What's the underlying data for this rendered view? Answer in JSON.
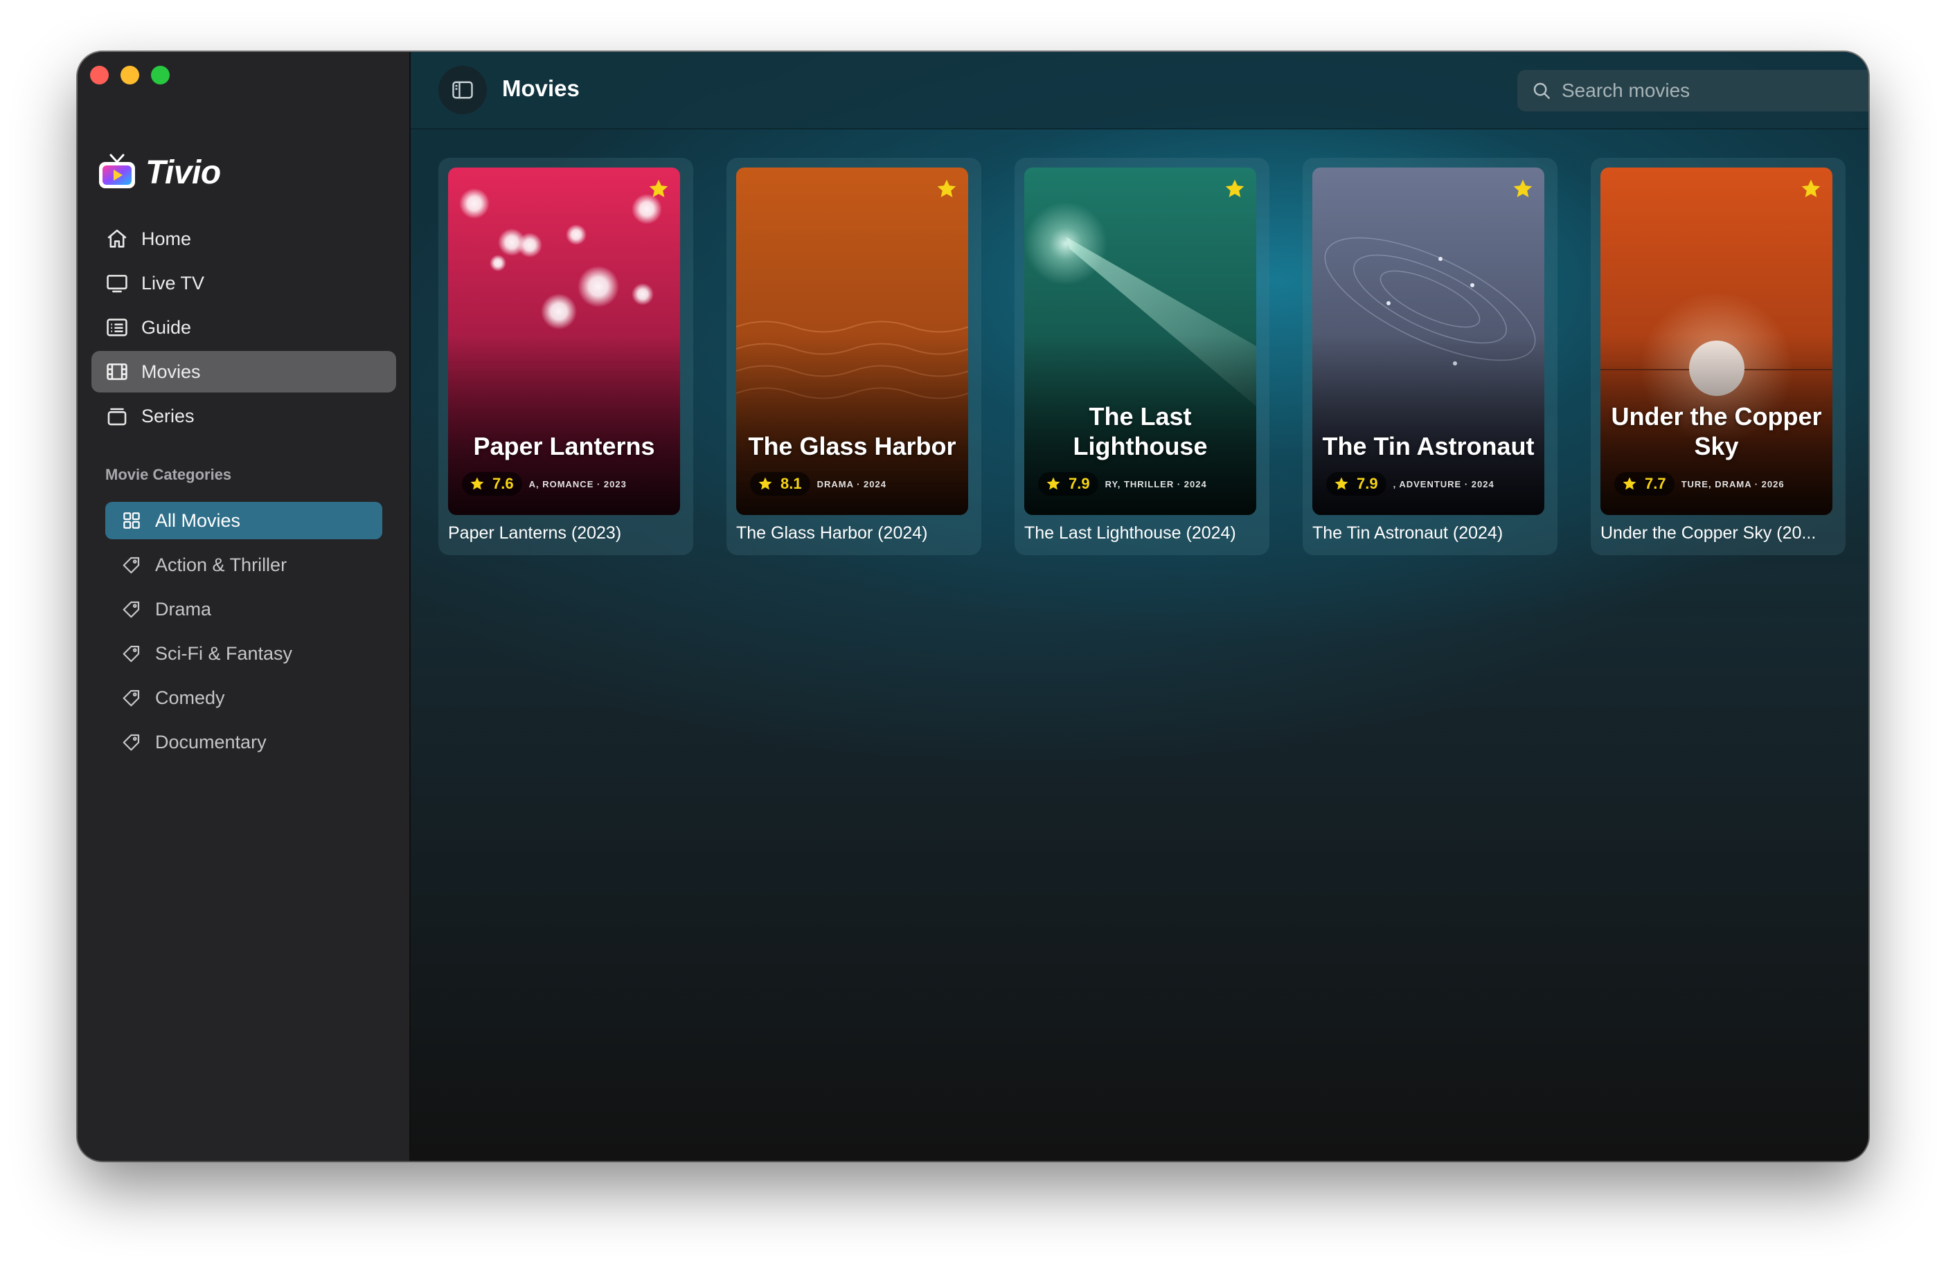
{
  "app": {
    "name": "Tivio"
  },
  "nav": {
    "items": [
      {
        "label": "Home",
        "icon": "home-icon"
      },
      {
        "label": "Live TV",
        "icon": "tv-icon"
      },
      {
        "label": "Guide",
        "icon": "guide-icon"
      },
      {
        "label": "Movies",
        "icon": "film-icon",
        "active": true
      },
      {
        "label": "Series",
        "icon": "series-icon"
      }
    ]
  },
  "categories": {
    "heading": "Movie Categories",
    "items": [
      {
        "label": "All Movies",
        "icon": "grid-icon",
        "active": true
      },
      {
        "label": "Action & Thriller",
        "icon": "tag-icon"
      },
      {
        "label": "Drama",
        "icon": "tag-icon"
      },
      {
        "label": "Sci-Fi & Fantasy",
        "icon": "tag-icon"
      },
      {
        "label": "Comedy",
        "icon": "tag-icon"
      },
      {
        "label": "Documentary",
        "icon": "tag-icon"
      }
    ]
  },
  "header": {
    "title": "Movies",
    "search_placeholder": "Search movies"
  },
  "movies": [
    {
      "poster_title": "Paper Lanterns",
      "rating": "7.6",
      "meta": "A, ROMANCE · 2023",
      "caption": "Paper Lanterns (2023)",
      "favorite": true,
      "palette": [
        "#e3285a",
        "#6a0f2f"
      ]
    },
    {
      "poster_title": "The Glass Harbor",
      "rating": "8.1",
      "meta": "DRAMA · 2024",
      "caption": "The Glass Harbor (2024)",
      "favorite": true,
      "palette": [
        "#c65a18",
        "#6e2c10"
      ]
    },
    {
      "poster_title": "The Last Lighthouse",
      "rating": "7.9",
      "meta": "RY, THRILLER · 2024",
      "caption": "The Last Lighthouse (2024)",
      "favorite": true,
      "palette": [
        "#1e7a6a",
        "#0f3f3a"
      ]
    },
    {
      "poster_title": "The Tin Astronaut",
      "rating": "7.9",
      "meta": ", ADVENTURE · 2024",
      "caption": "The Tin Astronaut (2024)",
      "favorite": true,
      "palette": [
        "#6b7590",
        "#2a2f40"
      ]
    },
    {
      "poster_title": "Under the Copper Sky",
      "rating": "7.7",
      "meta": "TURE, DRAMA · 2026",
      "caption": "Under the Copper Sky (20...",
      "favorite": true,
      "palette": [
        "#d5521a",
        "#5a220b"
      ]
    }
  ],
  "colors": {
    "accent": "#2f6f8a",
    "star": "#f7d417"
  }
}
